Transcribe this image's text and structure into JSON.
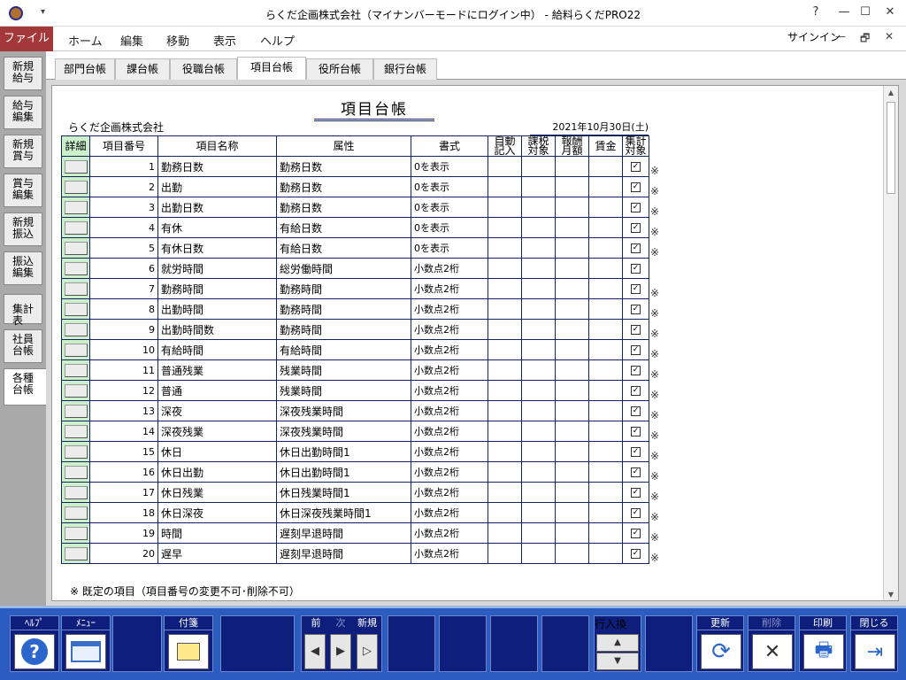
{
  "window": {
    "title": "らくだ企画株式会社（マイナンバーモードにログイン中） - 給料らくだPRO22",
    "help_glyph": "?",
    "minimize_glyph": "—",
    "restore_glyph": "☐",
    "close_glyph": "✕",
    "qa_glyph": "▾"
  },
  "ribbon": {
    "file": "ファイル",
    "tabs": [
      "ホーム",
      "編集",
      "移動",
      "表示",
      "ヘルプ"
    ],
    "signin": "サインイン",
    "min_glyph": "—",
    "restore_glyph": "🗗",
    "close_glyph": "✕"
  },
  "side_tabs": [
    "新規\n給与",
    "給与\n編集",
    "新規\n賞与",
    "賞与\n編集",
    "新規\n振込",
    "振込\n編集",
    "集計表",
    "社員\n台帳",
    "各種\n台帳"
  ],
  "top_tabs": [
    "部門台帳",
    "課台帳",
    "役職台帳",
    "項目台帳",
    "役所台帳",
    "銀行台帳"
  ],
  "document": {
    "title": "項目台帳",
    "company": "らくだ企画株式会社",
    "date": "2021年10月30日(土)",
    "footnote": "※ 既定の項目（項目番号の変更不可･削除不可）"
  },
  "table": {
    "headers": [
      "詳細",
      "項目番号",
      "項目名称",
      "属性",
      "書式",
      "自動\n記入",
      "課税\n対象",
      "報酬\n月額",
      "賃金",
      "集計\n対象"
    ],
    "rows": [
      {
        "no": "1",
        "name": "勤務日数",
        "attr": "勤務日数",
        "fmt": "0を表示",
        "mark": "※"
      },
      {
        "no": "2",
        "name": "出勤",
        "attr": "勤務日数",
        "fmt": "0を表示",
        "mark": "※"
      },
      {
        "no": "3",
        "name": "出勤日数",
        "attr": "勤務日数",
        "fmt": "0を表示",
        "mark": "※"
      },
      {
        "no": "4",
        "name": "有休",
        "attr": "有給日数",
        "fmt": "0を表示",
        "mark": "※"
      },
      {
        "no": "5",
        "name": "有休日数",
        "attr": "有給日数",
        "fmt": "0を表示",
        "mark": "※"
      },
      {
        "no": "6",
        "name": "就労時間",
        "attr": "総労働時間",
        "fmt": "小数点2桁",
        "mark": ""
      },
      {
        "no": "7",
        "name": "勤務時間",
        "attr": "勤務時間",
        "fmt": "小数点2桁",
        "mark": "※"
      },
      {
        "no": "8",
        "name": "出勤時間",
        "attr": "勤務時間",
        "fmt": "小数点2桁",
        "mark": "※"
      },
      {
        "no": "9",
        "name": "出勤時間数",
        "attr": "勤務時間",
        "fmt": "小数点2桁",
        "mark": "※"
      },
      {
        "no": "10",
        "name": "有給時間",
        "attr": "有給時間",
        "fmt": "小数点2桁",
        "mark": "※"
      },
      {
        "no": "11",
        "name": "普通残業",
        "attr": "残業時間",
        "fmt": "小数点2桁",
        "mark": "※"
      },
      {
        "no": "12",
        "name": "普通",
        "attr": "残業時間",
        "fmt": "小数点2桁",
        "mark": "※"
      },
      {
        "no": "13",
        "name": "深夜",
        "attr": "深夜残業時間",
        "fmt": "小数点2桁",
        "mark": "※"
      },
      {
        "no": "14",
        "name": "深夜残業",
        "attr": "深夜残業時間",
        "fmt": "小数点2桁",
        "mark": "※"
      },
      {
        "no": "15",
        "name": "休日",
        "attr": "休日出勤時間1",
        "fmt": "小数点2桁",
        "mark": "※"
      },
      {
        "no": "16",
        "name": "休日出勤",
        "attr": "休日出勤時間1",
        "fmt": "小数点2桁",
        "mark": "※"
      },
      {
        "no": "17",
        "name": "休日残業",
        "attr": "休日残業時間1",
        "fmt": "小数点2桁",
        "mark": "※"
      },
      {
        "no": "18",
        "name": "休日深夜",
        "attr": "休日深夜残業時間1",
        "fmt": "小数点2桁",
        "mark": "※"
      },
      {
        "no": "19",
        "name": "時間",
        "attr": "遅刻早退時間",
        "fmt": "小数点2桁",
        "mark": "※"
      },
      {
        "no": "20",
        "name": "遅早",
        "attr": "遅刻早退時間",
        "fmt": "小数点2桁",
        "mark": "※"
      }
    ],
    "checked_glyph": "✓"
  },
  "toolbar": {
    "help": "ﾍﾙﾌﾟ",
    "menu": "ﾒﾆｭｰ",
    "tag": "付箋",
    "prev": "前",
    "next": "次",
    "new": "新規",
    "row_swap": "行入換",
    "update": "更新",
    "delete": "削除",
    "print": "印刷",
    "close": "閉じる",
    "help_icon": "?",
    "up_glyph": "▲",
    "down_glyph": "▼",
    "prev_glyph": "◀",
    "next_glyph": "▶",
    "new_glyph": "▷",
    "update_glyph": "⟳",
    "delete_glyph": "✕",
    "print_glyph": "🖶",
    "close_glyph": "⇥"
  },
  "colors": {
    "file_tab": "#a4373a",
    "toolbar_bg": "#2a5dbf",
    "button_bg": "#0d1e7c",
    "grid_line": "#14245e",
    "detail_col": "#ccf0cc"
  }
}
